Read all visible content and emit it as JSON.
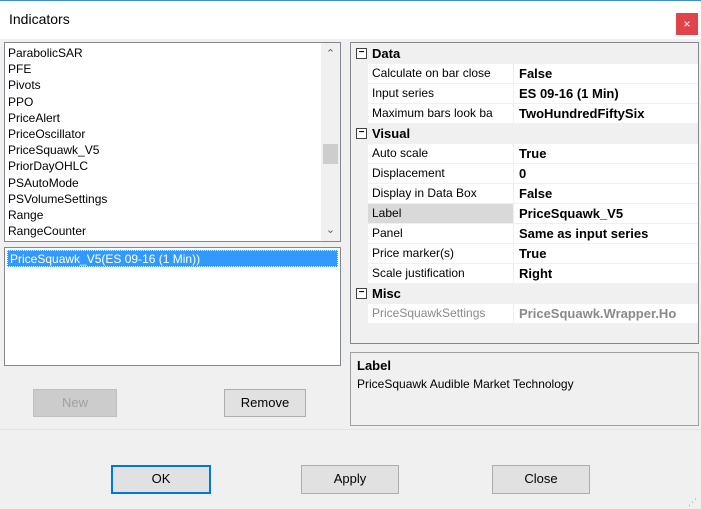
{
  "window": {
    "title": "Indicators",
    "close_label": "×"
  },
  "indicator_list": {
    "items": [
      "ParabolicSAR",
      "PFE",
      "Pivots",
      "PPO",
      "PriceAlert",
      "PriceOscillator",
      "PriceSquawk_V5",
      "PriorDayOHLC",
      "PSAutoMode",
      "PSVolumeSettings",
      "Range",
      "RangeCounter"
    ],
    "scroll_up": "⌃",
    "scroll_down": "⌄"
  },
  "applied_list": {
    "items": [
      "PriceSquawk_V5(ES 09-16 (1 Min))"
    ]
  },
  "left_buttons": {
    "new_label": "New",
    "remove_label": "Remove"
  },
  "properties": {
    "data": {
      "category": "Data",
      "rows": [
        {
          "name": "Calculate on bar close",
          "value": "False"
        },
        {
          "name": "Input series",
          "value": "ES 09-16 (1 Min)"
        },
        {
          "name": "Maximum bars look ba",
          "value": "TwoHundredFiftySix"
        }
      ]
    },
    "visual": {
      "category": "Visual",
      "rows": [
        {
          "name": "Auto scale",
          "value": "True"
        },
        {
          "name": "Displacement",
          "value": "0"
        },
        {
          "name": "Display in Data Box",
          "value": "False"
        },
        {
          "name": "Label",
          "value": "PriceSquawk_V5"
        },
        {
          "name": "Panel",
          "value": "Same as input series"
        },
        {
          "name": "Price marker(s)",
          "value": "True"
        },
        {
          "name": "Scale justification",
          "value": "Right"
        }
      ]
    },
    "misc": {
      "category": "Misc",
      "rows": [
        {
          "name": "PriceSquawkSettings",
          "value": "PriceSquawk.Wrapper.Ho"
        }
      ]
    },
    "collapse_glyph": "−"
  },
  "description": {
    "title": "Label",
    "text": "PriceSquawk Audible Market Technology"
  },
  "dialog_buttons": {
    "ok": "OK",
    "apply": "Apply",
    "close": "Close"
  }
}
